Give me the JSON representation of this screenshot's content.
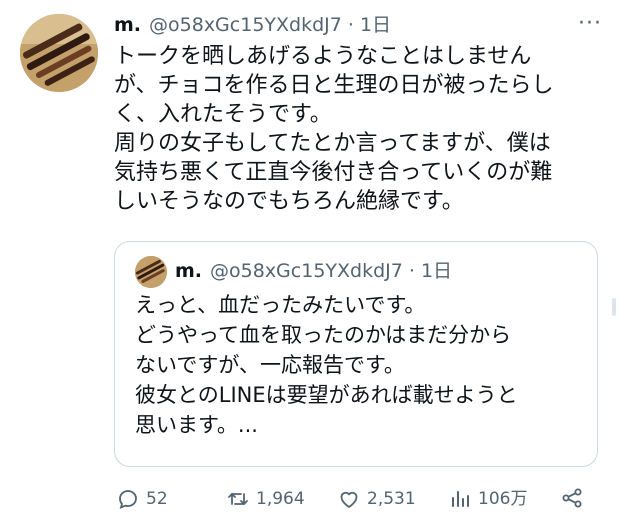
{
  "tweet": {
    "author_name": "m.",
    "meta": "@o58xGc15YXdkdJ7 · 1日",
    "more_label": "···",
    "lines": [
      "トークを晒しあげるようなことはしません",
      "が、チョコを作る日と生理の日が被ったらし",
      "く、入れたそうです。",
      "周りの女子もしてたとか言ってますが、僕は",
      "気持ち悪くて正直今後付き合っていくのが難",
      "しいそうなのでもちろん絶縁です。"
    ]
  },
  "quoted_tweet": {
    "author_name": "m.",
    "meta": "@o58xGc15YXdkdJ7 · 1日",
    "lines": [
      "えっと、血だったみたいです。",
      "どうやって血を取ったのかはまだ分から",
      "ないですが、一応報告です。",
      "彼女とのLINEは要望があれば載せようと",
      "思います。..."
    ]
  },
  "actions": {
    "replies": "52",
    "retweets": "1,964",
    "likes": "2,531",
    "views": "106万"
  },
  "colors": {
    "text": "#0f1419",
    "secondary": "#536471",
    "border": "#cfd9de"
  },
  "icons": [
    "reply-icon",
    "retweet-icon",
    "like-icon",
    "views-icon",
    "share-icon",
    "more-icon"
  ]
}
